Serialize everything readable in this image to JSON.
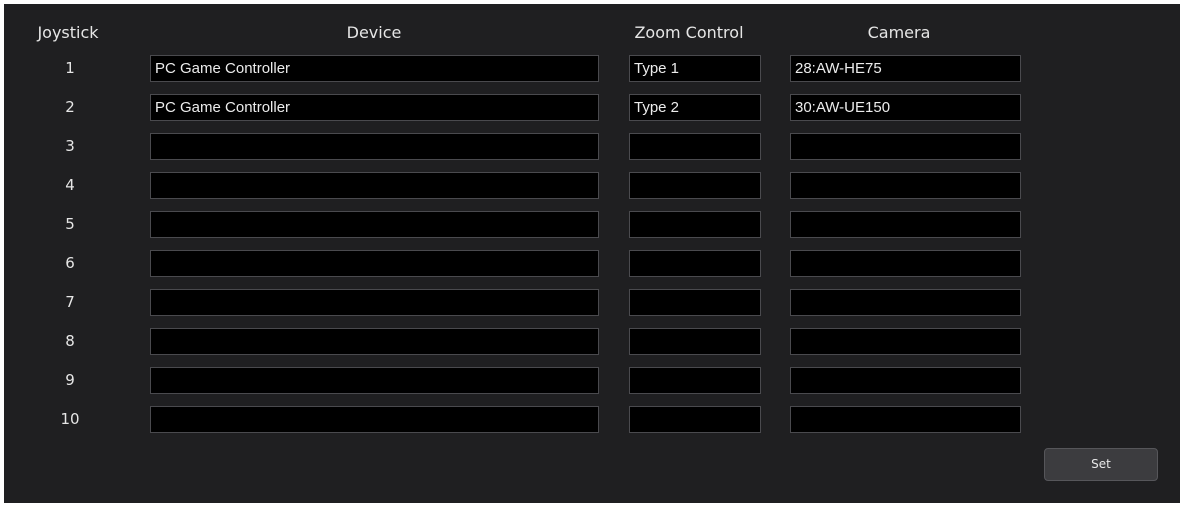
{
  "headers": {
    "joystick": "Joystick",
    "device": "Device",
    "zoom_control": "Zoom Control",
    "camera": "Camera"
  },
  "rows": [
    {
      "number": "1",
      "device": "PC Game Controller",
      "zoom": "Type 1",
      "camera": "28:AW-HE75"
    },
    {
      "number": "2",
      "device": "PC Game Controller",
      "zoom": "Type 2",
      "camera": "30:AW-UE150"
    },
    {
      "number": "3",
      "device": "",
      "zoom": "",
      "camera": ""
    },
    {
      "number": "4",
      "device": "",
      "zoom": "",
      "camera": ""
    },
    {
      "number": "5",
      "device": "",
      "zoom": "",
      "camera": ""
    },
    {
      "number": "6",
      "device": "",
      "zoom": "",
      "camera": ""
    },
    {
      "number": "7",
      "device": "",
      "zoom": "",
      "camera": ""
    },
    {
      "number": "8",
      "device": "",
      "zoom": "",
      "camera": ""
    },
    {
      "number": "9",
      "device": "",
      "zoom": "",
      "camera": ""
    },
    {
      "number": "10",
      "device": "",
      "zoom": "",
      "camera": ""
    }
  ],
  "set_button": {
    "label": "Set"
  },
  "colors": {
    "panel_background": "#1f1f21",
    "field_background": "#000000",
    "field_border": "#4a4a4e",
    "text": "#e6e6e6",
    "button_background": "#3c3c3f"
  }
}
